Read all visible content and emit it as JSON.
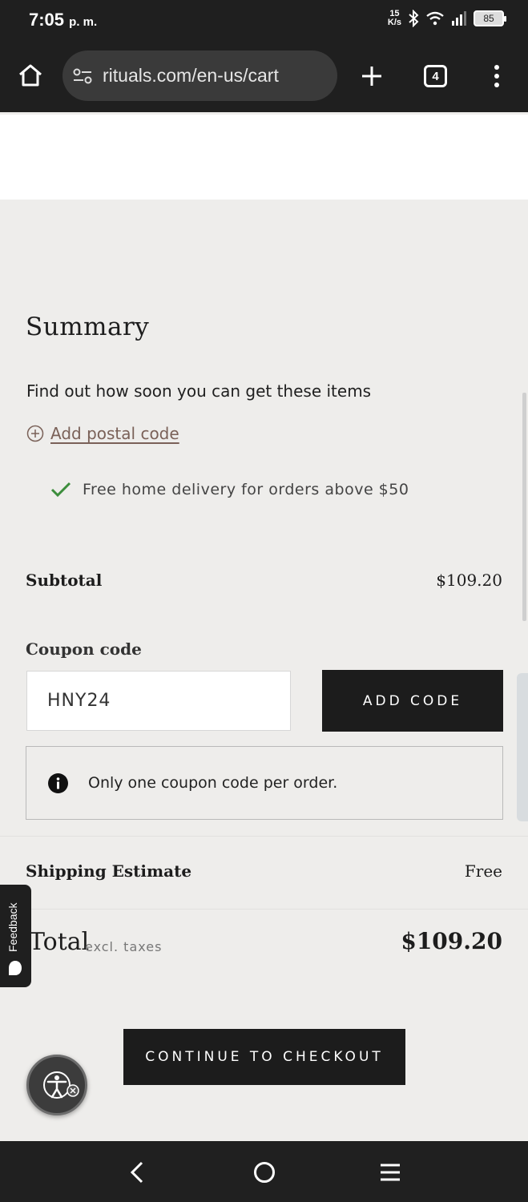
{
  "status_bar": {
    "time": "7:05",
    "ampm": "p. m.",
    "speed_top": "15",
    "speed_bottom": "K/s",
    "battery": "85"
  },
  "browser": {
    "url": "rituals.com/en-us/cart",
    "tab_count": "4"
  },
  "summary": {
    "title": "Summary",
    "find_out_text": "Find out how soon you can get these items",
    "add_postal_link": "Add postal code",
    "delivery_note": "Free home delivery for orders above $50",
    "subtotal_label": "Subtotal",
    "subtotal_value": "$109.20",
    "coupon_label": "Coupon code",
    "coupon_value": "HNY24",
    "add_code_button": "ADD CODE",
    "coupon_info": "Only one coupon code per order.",
    "shipping_label": "Shipping Estimate",
    "shipping_value": "Free",
    "total_label": "Total",
    "total_sub": "excl. taxes",
    "total_value": "$109.20",
    "checkout_button": "CONTINUE TO CHECKOUT"
  },
  "feedback": {
    "label": "Feedback"
  },
  "colors": {
    "page_bg": "#eeedeb",
    "button_bg": "#1c1c1c",
    "link": "#7a6158",
    "check": "#3c8d3c"
  }
}
